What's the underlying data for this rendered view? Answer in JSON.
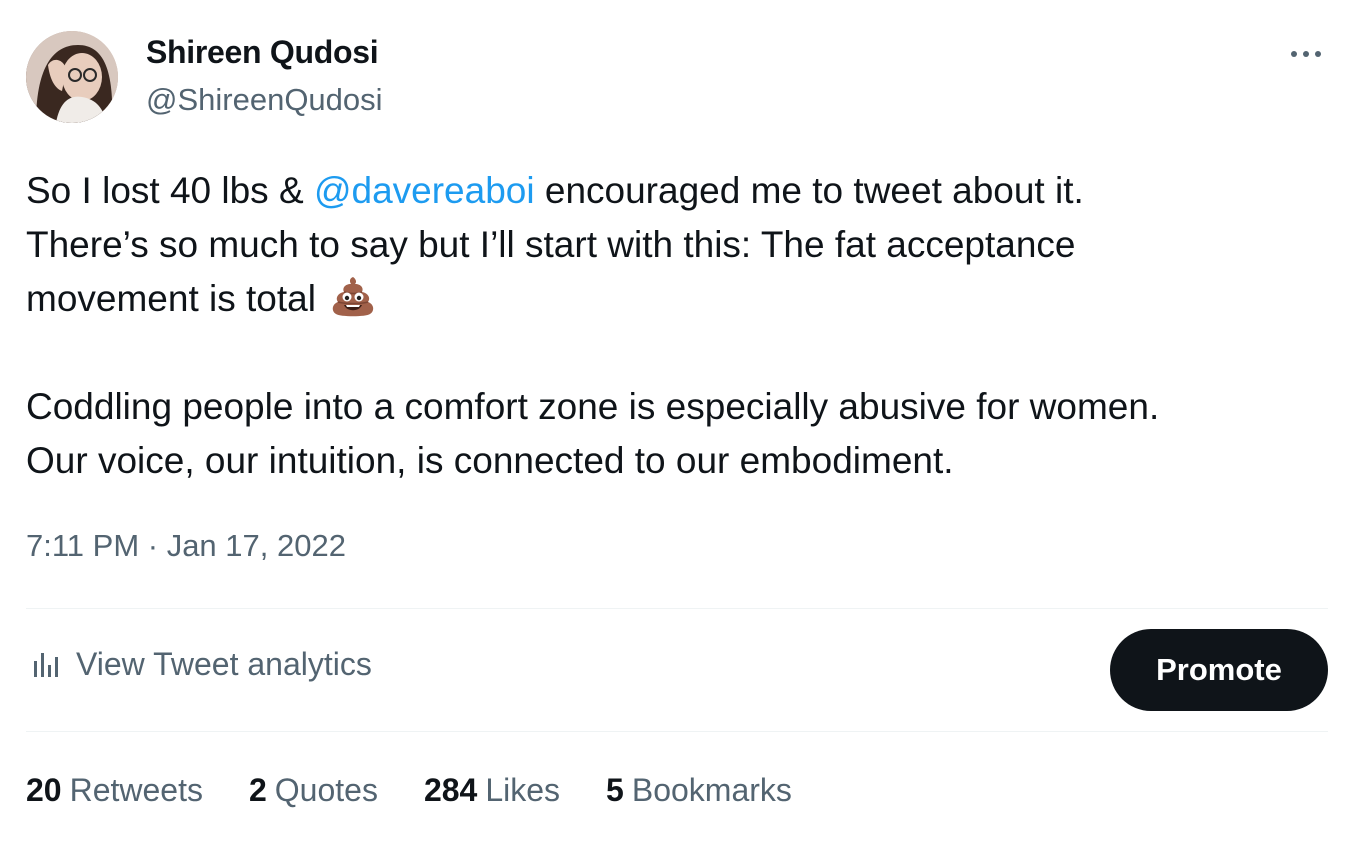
{
  "author": {
    "display_name": "Shireen Qudosi",
    "handle": "@ShireenQudosi"
  },
  "tweet": {
    "line1_pre": "So I lost 40 lbs & ",
    "mention": "@davereaboi",
    "line1_post": " encouraged me to tweet about it.",
    "line2": "There’s so much to say but I’ll start with this: The fat acceptance",
    "line3": "movement is total",
    "emoji": "pile-of-poo-emoji",
    "line4": "Coddling people into a comfort zone is especially abusive for women.",
    "line5": "Our voice, our intuition, is connected to our embodiment.",
    "timestamp": "7:11 PM · Jan 17, 2022"
  },
  "actions": {
    "analytics_label": "View Tweet analytics",
    "promote_label": "Promote"
  },
  "stats": [
    {
      "count": "20",
      "label": "Retweets"
    },
    {
      "count": "2",
      "label": "Quotes"
    },
    {
      "count": "284",
      "label": "Likes"
    },
    {
      "count": "5",
      "label": "Bookmarks"
    }
  ],
  "colors": {
    "link": "#1d9bf0",
    "text": "#0f1419",
    "secondary": "#536471",
    "promote_bg": "#0f1419"
  }
}
